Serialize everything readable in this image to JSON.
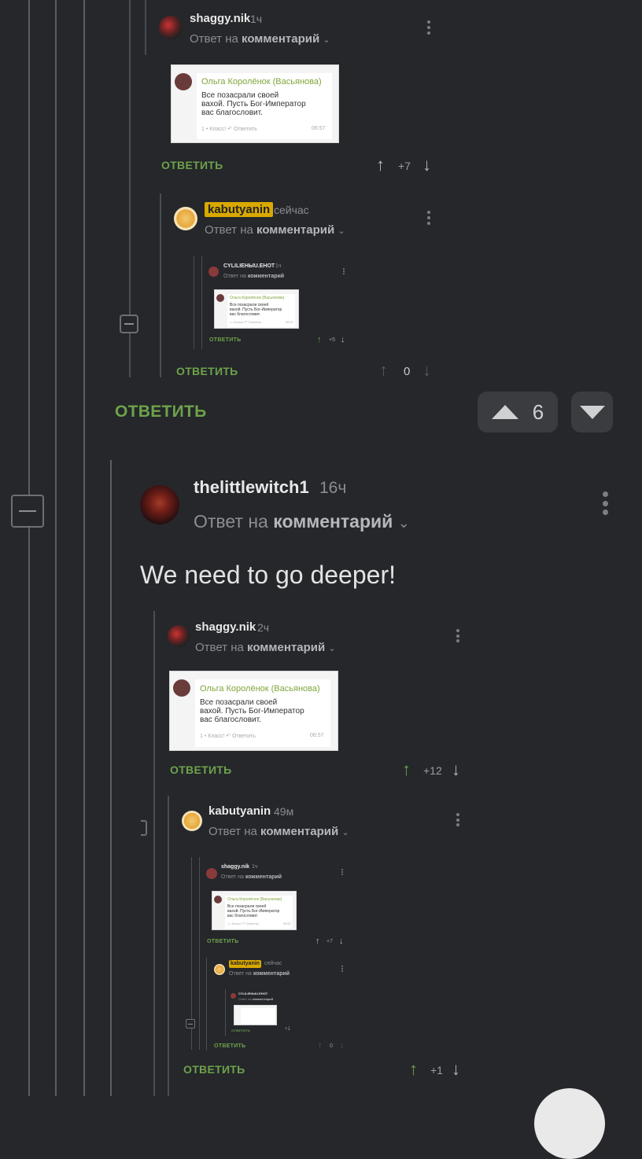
{
  "thread1": {
    "c1": {
      "author": "shaggy.nik",
      "time": "1ч",
      "reply_prefix": "Ответ на",
      "reply_target": "комментарий",
      "reply_label": "ОТВЕТИТЬ",
      "score": "+7"
    },
    "c1_shot": {
      "author": "Ольга Королёнок (Васьянова)",
      "text": "Все позасрали своей\nвахой. Пусть Бог-Император\nвас благословит.",
      "meta": "1 • Класс!  ↶ Ответить",
      "time": "06:57"
    },
    "c2": {
      "author": "kabutyanin",
      "time": "сейчас",
      "reply_prefix": "Ответ на",
      "reply_target": "комментарий",
      "reply_label": "ОТВЕТИТЬ",
      "score": "0"
    },
    "c2_nested": {
      "author": "CYLILIEHЫU.EHOT",
      "time": "1ч",
      "reply_prefix": "Ответ на",
      "reply_target": "комментарий",
      "reply_label": "ОТВЕТИТЬ",
      "score": "+5"
    },
    "c2_nested_shot": {
      "author": "Ольга Королёнок (Васьянова)",
      "text": "Все позасрали своей\nвахой. Пусть Бог-Император\nвас благословит.",
      "meta": "1 • Класс!  ↶ Ответить",
      "time": "06:57"
    }
  },
  "parent": {
    "reply_label": "ОТВЕТИТЬ",
    "score": "6"
  },
  "main": {
    "author": "thelittlewitch1",
    "time": "16ч",
    "reply_prefix": "Ответ на",
    "reply_target": "комментарий",
    "text": "We need to go deeper!"
  },
  "thread2": {
    "c1": {
      "author": "shaggy.nik",
      "time": "2ч",
      "reply_prefix": "Ответ на",
      "reply_target": "комментарий",
      "reply_label": "ОТВЕТИТЬ",
      "score": "+12"
    },
    "c1_shot": {
      "author": "Ольга Королёнок (Васьянова)",
      "text": "Все позасрали своей\nвахой. Пусть Бог-Император\nвас благословит.",
      "meta": "1 • Класс!  ↶ Ответить",
      "time": "06:57"
    },
    "c2": {
      "author": "kabutyanin",
      "time": "49м",
      "reply_prefix": "Ответ на",
      "reply_target": "комментарий",
      "reply_label": "ОТВЕТИТЬ",
      "score": "+1"
    },
    "n1": {
      "author": "shaggy.nik",
      "time": "1ч",
      "reply_prefix": "Ответ на",
      "reply_target": "комментарий",
      "reply_label": "ОТВЕТИТЬ",
      "score": "+7"
    },
    "n1_shot": {
      "author": "Ольга Королёнок (Васьянова)",
      "text": "Все позасрали своей\nвахой. Пусть Бог-Император\nвас благословит.",
      "meta": "1 • Класс!  ↶ Ответить",
      "time": "06:57"
    },
    "n2": {
      "author": "kabutyanin",
      "time": "сейчас",
      "reply_prefix": "Ответ на",
      "reply_target": "комментарий",
      "reply_label": "ОТВЕТИТЬ",
      "score": "0"
    },
    "n3": {
      "author": "CYLILIEHЫU.EHOT",
      "time": "1ч",
      "reply_prefix": "Ответ на",
      "reply_target": "комментарий",
      "reply_label": "ОТВЕТИТЬ",
      "score": "+1"
    }
  },
  "colors": {
    "background": "#25272b",
    "green": "#6ea24a",
    "badge": "#d9a900"
  },
  "icons": [
    "arrow-up-icon",
    "arrow-down-icon",
    "more-vertical-icon",
    "chevron-down-icon",
    "collapse-icon"
  ]
}
